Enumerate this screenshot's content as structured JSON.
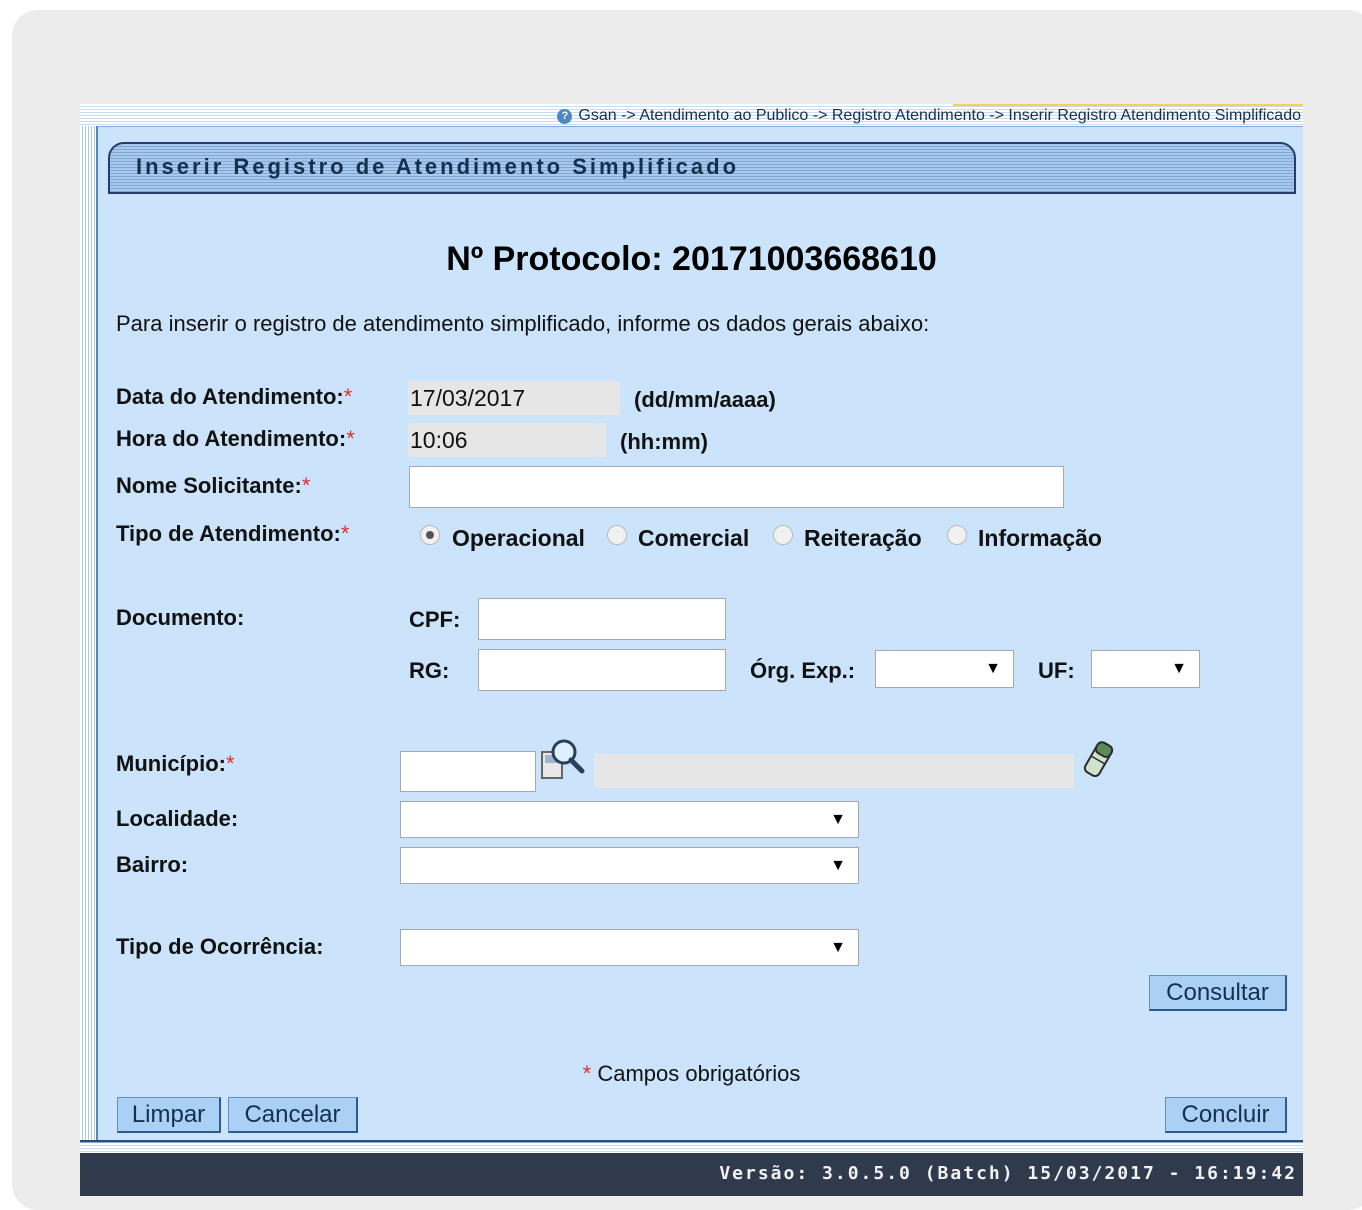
{
  "breadcrumb": "Gsan -> Atendimento ao Publico -> Registro Atendimento -> Inserir Registro Atendimento Simplificado",
  "page_title": "Inserir Registro de Atendimento Simplificado",
  "protocol": "Nº Protocolo: 20171003668610",
  "instruction": "Para inserir o registro de atendimento simplificado, informe os dados gerais abaixo:",
  "form": {
    "data_label": "Data do Atendimento:",
    "data_value": "17/03/2017",
    "data_hint": "(dd/mm/aaaa)",
    "hora_label": "Hora do Atendimento:",
    "hora_value": "10:06",
    "hora_hint": "(hh:mm)",
    "nome_label": "Nome Solicitante:",
    "nome_value": "",
    "tipo_label": "Tipo de Atendimento:",
    "tipo_options": [
      "Operacional",
      "Comercial",
      "Reiteração",
      "Informação"
    ],
    "tipo_selected": "Operacional",
    "documento_label": "Documento:",
    "cpf_label": "CPF:",
    "cpf_value": "",
    "rg_label": "RG:",
    "rg_value": "",
    "org_exp_label": "Órg. Exp.:",
    "org_exp_value": "",
    "uf_label": "UF:",
    "uf_value": "",
    "municipio_label": "Município:",
    "municipio_code": "",
    "municipio_name": "",
    "localidade_label": "Localidade:",
    "localidade_value": "",
    "bairro_label": "Bairro:",
    "bairro_value": "",
    "ocorrencia_label": "Tipo de Ocorrência:",
    "ocorrencia_value": "",
    "required_marker": "*"
  },
  "buttons": {
    "consultar": "Consultar",
    "limpar": "Limpar",
    "cancelar": "Cancelar",
    "concluir": "Concluir"
  },
  "required_note": "Campos obrigatórios",
  "version": "Versão: 3.0.5.0 (Batch) 15/03/2017 - 16:19:42",
  "icons": {
    "help": "help-icon",
    "search": "magnifier-icon",
    "clear": "eraser-icon"
  },
  "colors": {
    "panel": "#cbe4fb",
    "button": "#aad0f5",
    "footer": "#303a4d",
    "required": "#e03030"
  }
}
